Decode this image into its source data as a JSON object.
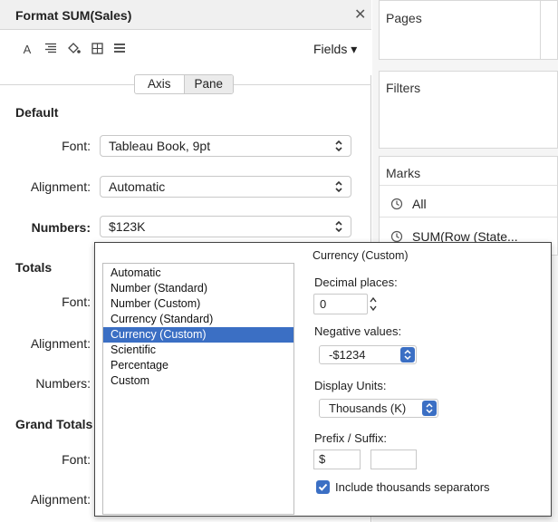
{
  "format_pane": {
    "title": "Format SUM(Sales)",
    "fields_label": "Fields ▾",
    "tabs": [
      {
        "label": "Axis"
      },
      {
        "label": "Pane"
      }
    ],
    "sections": {
      "default": {
        "heading": "Default",
        "font_label": "Font:",
        "font_value": "Tableau Book, 9pt",
        "alignment_label": "Alignment:",
        "alignment_value": "Automatic",
        "numbers_label": "Numbers:",
        "numbers_value": "$123K"
      },
      "totals": {
        "heading": "Totals",
        "font_label": "Font:",
        "alignment_label": "Alignment:",
        "numbers_label": "Numbers:"
      },
      "grand_totals": {
        "heading": "Grand Totals",
        "font_label": "Font:",
        "alignment_label": "Alignment:"
      }
    }
  },
  "shelves": {
    "pages": "Pages",
    "filters": "Filters",
    "marks": "Marks",
    "marks_all": "All",
    "marks_sum": "SUM(Row (State..."
  },
  "number_popup": {
    "formats": [
      "Automatic",
      "Number (Standard)",
      "Number (Custom)",
      "Currency (Standard)",
      "Currency (Custom)",
      "Scientific",
      "Percentage",
      "Custom"
    ],
    "selected_format": "Currency (Custom)",
    "title": "Currency (Custom)",
    "decimal_label": "Decimal places:",
    "decimal_value": "0",
    "negative_label": "Negative values:",
    "negative_value": "-$1234",
    "units_label": "Display Units:",
    "units_value": "Thousands (K)",
    "prefix_label": "Prefix / Suffix:",
    "prefix_value": "$",
    "suffix_value": "",
    "separators_label": "Include thousands separators"
  },
  "colors": {
    "accent": "#3b6fc4"
  }
}
